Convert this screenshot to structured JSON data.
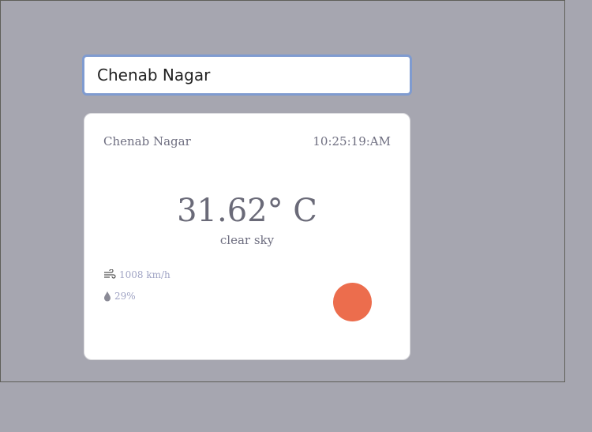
{
  "search": {
    "value": "Chenab Nagar"
  },
  "weather": {
    "city": "Chenab Nagar",
    "time": "10:25:19:AM",
    "temperature": "31.62° C",
    "description": "clear sky",
    "wind": "1008 km/h",
    "humidity": "29%",
    "icons": {
      "wind": "wind-icon",
      "humidity": "droplet-icon",
      "condition": "sun-icon"
    },
    "sun_color": "#ec6d4d"
  }
}
